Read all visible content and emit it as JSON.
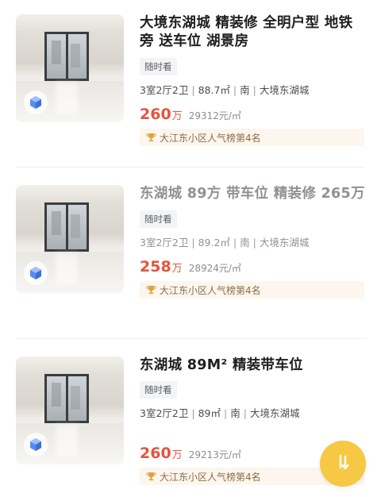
{
  "listings": [
    {
      "title": "大境东湖城 精装修  全明户型 地铁旁 送车位 湖景房",
      "tag": "随时看",
      "layout": "3室2厅2卫",
      "area": "88.7㎡",
      "orientation": "南",
      "community": "大境东湖城",
      "price": "260",
      "price_unit": "万",
      "unit_price": "29312元/㎡",
      "rank": "大江东小区人气榜第4名",
      "viewed": false
    },
    {
      "title": "东湖城 89方 带车位 精装修 265万",
      "tag": "随时看",
      "layout": "3室2厅2卫",
      "area": "89.2㎡",
      "orientation": "南",
      "community": "大境东湖城",
      "price": "258",
      "price_unit": "万",
      "unit_price": "28924元/㎡",
      "rank": "大江东小区人气榜第4名",
      "viewed": true
    },
    {
      "title": "东湖城 89M² 精装带车位",
      "tag": "随时看",
      "layout": "3室2厅2卫",
      "area": "89㎡",
      "orientation": "南",
      "community": "大境东湖城",
      "price": "260",
      "price_unit": "万",
      "unit_price": "29213元/㎡",
      "rank": "大江东小区人气榜第4名",
      "viewed": false
    }
  ],
  "fab": {
    "icon": "sort-icon",
    "label": "1l",
    "color": "#f7c843"
  },
  "colors": {
    "price": "#e5533d",
    "rank_bg": "#fdf6ee",
    "rank_text": "#8a6d45",
    "tag_bg": "#f3f4f6"
  }
}
